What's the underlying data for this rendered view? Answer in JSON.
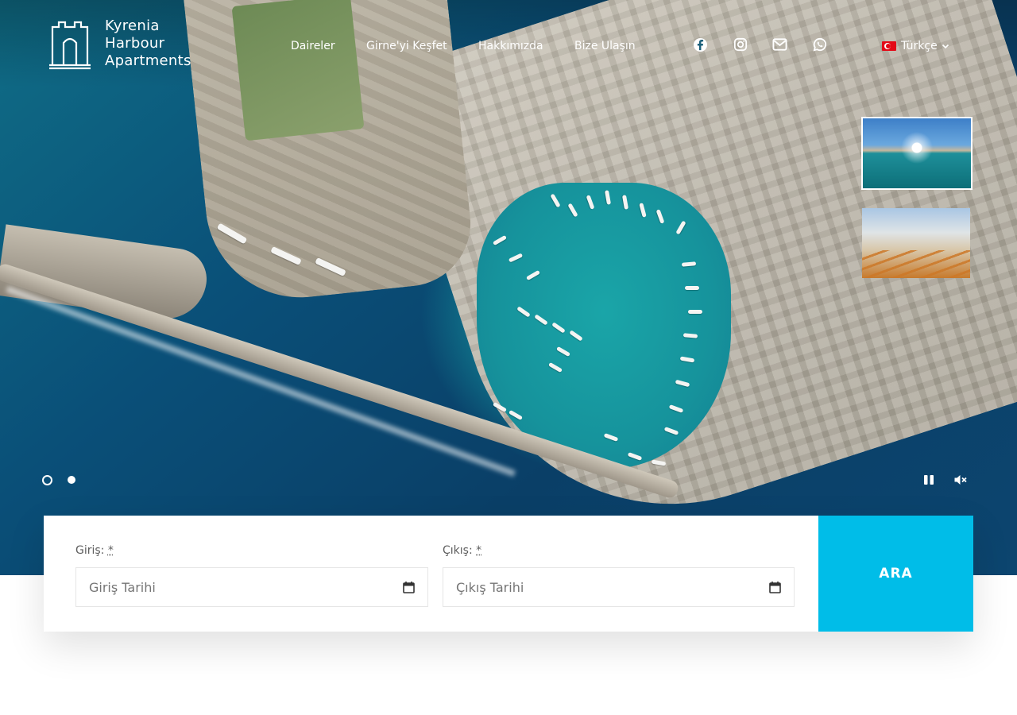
{
  "brand": {
    "line1": "Kyrenia",
    "line2": "Harbour",
    "line3": "Apartments"
  },
  "nav": {
    "items": [
      "Daireler",
      "Girne'yi Keşfet",
      "Hakkımızda",
      "Bize Ulaşın"
    ]
  },
  "social": {
    "icons": [
      "facebook-icon",
      "instagram-icon",
      "email-icon",
      "whatsapp-icon"
    ]
  },
  "language": {
    "selected": "Türkçe",
    "flag": "turkey-flag-icon"
  },
  "slider": {
    "slides": 2,
    "active_dot": 1,
    "thumbnails": [
      "harbour-panorama-thumbnail",
      "harbour-sunset-thumbnail"
    ],
    "controls": [
      "pause-icon",
      "mute-icon"
    ]
  },
  "booking": {
    "checkin_label": "Giriş:",
    "checkin_required": "*",
    "checkin_placeholder": "Giriş Tarihi",
    "checkout_label": "Çıkış:",
    "checkout_required": "*",
    "checkout_placeholder": "Çıkış Tarihi",
    "search_label": "ARA"
  },
  "colors": {
    "accent": "#00bde8",
    "text_muted": "#5d5d5d",
    "input_border": "#e6e6e6"
  }
}
